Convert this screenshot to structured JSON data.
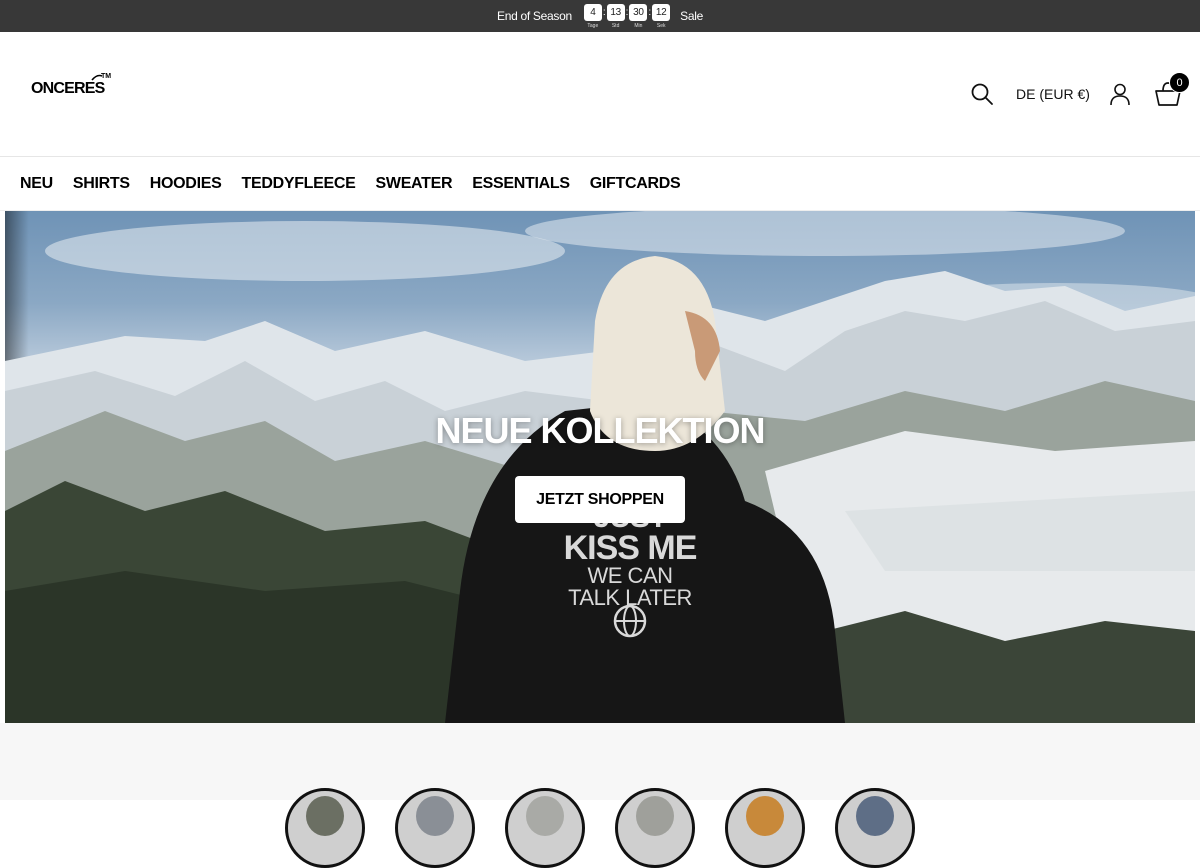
{
  "announcement": {
    "left_text": "End of Season",
    "right_text": "Sale",
    "countdown": [
      {
        "value": "4",
        "label": "Tage"
      },
      {
        "value": "13",
        "label": "Std"
      },
      {
        "value": "30",
        "label": "Min"
      },
      {
        "value": "12",
        "label": "Sek"
      }
    ]
  },
  "header": {
    "logo_text": "ONCERES",
    "logo_tm": "TM",
    "locale": "DE (EUR €)",
    "cart_count": "0"
  },
  "nav": {
    "items": [
      "NEU",
      "SHIRTS",
      "HOODIES",
      "TEDDYFLEECE",
      "SWEATER",
      "ESSENTIALS",
      "GIFTCARDS"
    ]
  },
  "hero": {
    "title": "NEUE KOLLEKTION",
    "cta": "JETZT SHOPPEN",
    "print_line1": "JUST",
    "print_line2": "KISS ME",
    "print_line3": "WE CAN",
    "print_line4": "TALK LATER"
  },
  "categories": {
    "count": 6,
    "colors": [
      "#6b6f63",
      "#8a8f96",
      "#a9aaa6",
      "#9fa09b",
      "#c8893a",
      "#5e6e86"
    ]
  },
  "colors": {
    "announce_bg": "#383838",
    "badge_bg": "#000000",
    "strip_bg": "#f7f7f7"
  }
}
